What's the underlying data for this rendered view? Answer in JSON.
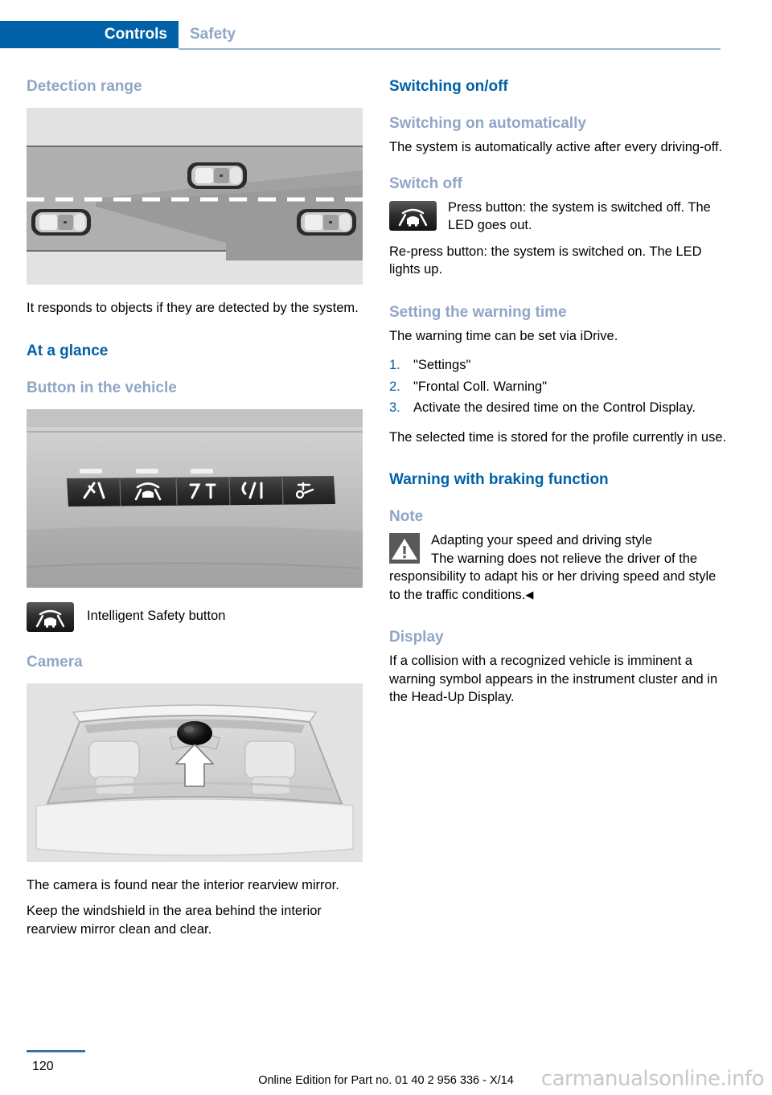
{
  "header": {
    "active_tab": "Controls",
    "inactive_tab": "Safety",
    "active_bg": "#0061A8",
    "inactive_color": "#8FA6C6"
  },
  "colors": {
    "heading_primary": "#0061A8",
    "heading_secondary": "#8FA6C6",
    "body_text": "#000000",
    "figure_bg": "#E2E2E2",
    "list_number": "#0061A8"
  },
  "left_column": {
    "heading_detection_range": "Detection range",
    "figure_detection_range": "detection-range-diagram",
    "para_responds": "It responds to objects if they are detected by the system.",
    "heading_at_a_glance": "At a glance",
    "heading_button_in_vehicle": "Button in the vehicle",
    "figure_button_panel": "vehicle-button-panel-photo",
    "caption_intelligent_safety": "Intelligent Safety button",
    "icon_intelligent_safety": "intelligent-safety-button-icon",
    "heading_camera": "Camera",
    "figure_camera": "windshield-camera-photo",
    "para_camera_found": "The camera is found near the interior rearview mirror.",
    "para_keep_windshield": "Keep the windshield in the area behind the interior rearview mirror clean and clear."
  },
  "right_column": {
    "heading_switching_onoff": "Switching on/off",
    "heading_switching_on_auto": "Switching on automatically",
    "para_auto_active": "The system is automatically active after every driving-off.",
    "heading_switch_off": "Switch off",
    "icon_switch_off": "intelligent-safety-button-icon",
    "para_press_button": "Press button: the system is switched off. The LED goes out.",
    "para_repress_button": "Re-press button: the system is switched on. The LED lights up.",
    "heading_setting_warning_time": "Setting the warning time",
    "para_warning_time_idrive": "The warning time can be set via iDrive.",
    "steps": [
      {
        "num": "1.",
        "text": "\"Settings\""
      },
      {
        "num": "2.",
        "text": "\"Frontal Coll. Warning\""
      },
      {
        "num": "3.",
        "text": "Activate the desired time on the Control Display."
      }
    ],
    "para_selected_time_stored": "The selected time is stored for the profile currently in use.",
    "heading_warning_braking": "Warning with braking function",
    "heading_note": "Note",
    "icon_warning": "warning-triangle-icon",
    "note_title": "Adapting your speed and driving style",
    "note_body": "The warning does not relieve the driver of the responsibility to adapt his or her driving speed and style to the traffic conditions.",
    "note_end_mark": "◀",
    "heading_display": "Display",
    "para_display_body": "If a collision with a recognized vehicle is imminent a warning symbol appears in the instrument cluster and in the Head-Up Display."
  },
  "footer": {
    "page_number": "120",
    "edition_text": "Online Edition for Part no. 01 40 2 956 336 - X/14",
    "watermark": "carmanualsonline.info"
  }
}
